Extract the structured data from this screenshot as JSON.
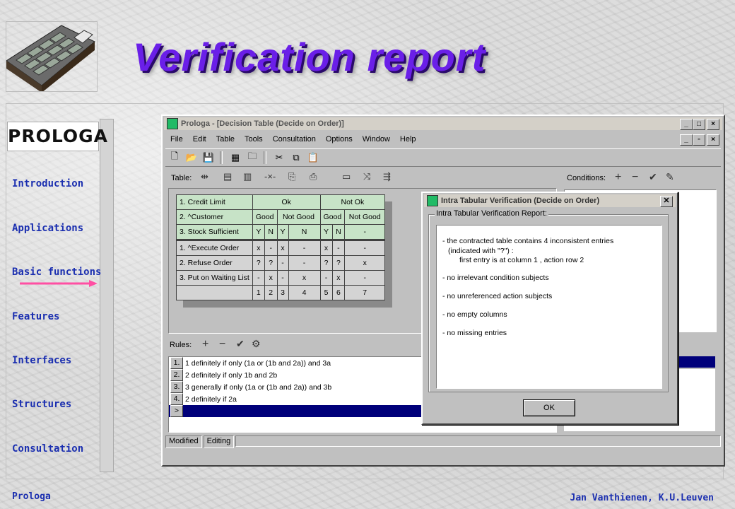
{
  "slide": {
    "title": "Verification report",
    "footer_left": "Prologa",
    "footer_right": "Jan Vanthienen, K.U.Leuven",
    "brand": "PROLOGA"
  },
  "nav": {
    "items": [
      "Introduction",
      "Applications",
      "Basic functions",
      "Features",
      "Interfaces",
      "Structures",
      "Consultation"
    ],
    "active_index": 2,
    "arrow_color": "#ff4fa3"
  },
  "window": {
    "title": "Prologa - [Decision Table (Decide on Order)]",
    "menu": [
      "File",
      "Edit",
      "Table",
      "Tools",
      "Consultation",
      "Options",
      "Window",
      "Help"
    ],
    "controls": [
      "_",
      "□",
      "×"
    ],
    "doc_controls": [
      "_",
      "▫",
      "×"
    ]
  },
  "table_pane": {
    "label": "Table:",
    "conditions_label": "Conditions:",
    "rules_label": "Rules:",
    "conditions": [
      {
        "label": "1.  Credit Limit",
        "cells": [
          {
            "v": "Ok",
            "span": 4
          },
          {
            "v": "Not Ok",
            "span": 3
          }
        ]
      },
      {
        "label": "2.  ^Customer",
        "cells": [
          {
            "v": "Good",
            "span": 2
          },
          {
            "v": "Not Good",
            "span": 2
          },
          {
            "v": "Good",
            "span": 2
          },
          {
            "v": "Not Good",
            "span": 1
          }
        ]
      },
      {
        "label": "3.  Stock Sufficient",
        "cells": [
          {
            "v": "Y",
            "span": 1
          },
          {
            "v": "N",
            "span": 1
          },
          {
            "v": "Y",
            "span": 1
          },
          {
            "v": "N",
            "span": 1
          },
          {
            "v": "Y",
            "span": 1
          },
          {
            "v": "N",
            "span": 1
          },
          {
            "v": "-",
            "span": 1
          }
        ]
      }
    ],
    "actions": [
      {
        "label": "1.  ^Execute Order",
        "cells": [
          "x",
          "-",
          "x",
          "-",
          "x",
          "-",
          "-"
        ]
      },
      {
        "label": "2.  Refuse Order",
        "cells": [
          "?",
          "?",
          "-",
          "-",
          "?",
          "?",
          "x"
        ]
      },
      {
        "label": "3.  Put on Waiting List",
        "cells": [
          "-",
          "x",
          "-",
          "x",
          "-",
          "x",
          "-"
        ]
      }
    ],
    "column_numbers": [
      "1",
      "2",
      "3",
      "4",
      "5",
      "6",
      "7"
    ]
  },
  "rules": [
    {
      "n": "1.",
      "text": "1 definitely if only (1a or (1b and 2a)) and 3a"
    },
    {
      "n": "2.",
      "text": "2 definitely if only 1b and 2b"
    },
    {
      "n": "3.",
      "text": "3 generally if only (1a or (1b and 2a)) and 3b"
    },
    {
      "n": "4.",
      "text": "2 definitely if 2a"
    },
    {
      "n": ">",
      "text": ""
    }
  ],
  "status": [
    "Modified",
    "Editing"
  ],
  "dialog": {
    "title": "Intra Tabular Verification (Decide on Order)",
    "group_label": "Intra Tabular Verification Report:",
    "lines": [
      "- the contracted table contains 4 inconsistent entries",
      "(indicated with \"?\") :",
      "first entry is at column 1 , action row 2",
      "- no irrelevant condition subjects",
      "- no unreferenced action subjects",
      "- no empty columns",
      "- no missing entries"
    ],
    "ok_label": "OK"
  }
}
